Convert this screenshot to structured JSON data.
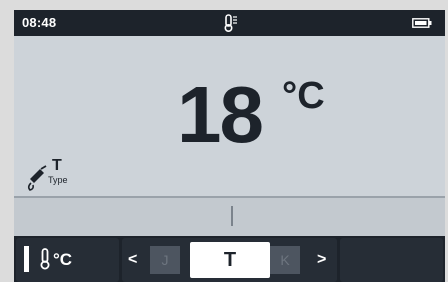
{
  "status": {
    "time": "08:48",
    "center_icon": "thermometer-icon",
    "battery_icon": "battery-icon"
  },
  "measurement": {
    "value": "18",
    "unit": "°C"
  },
  "thermocouple": {
    "icon": "thermocouple-probe-icon",
    "letter": "T",
    "label": "Type"
  },
  "softkeys": {
    "unit_key": {
      "icon": "thermometer-icon",
      "label": "°C"
    },
    "type_selector": {
      "prev_arrow": "<",
      "previous": "J",
      "selected": "T",
      "next": "K",
      "next_arrow": ">"
    },
    "right_key_label": ""
  },
  "colors": {
    "screen_bg": "#cdd3d9",
    "bar_dark": "#1d232b",
    "text_dark": "#1d232b",
    "selected_bg": "#ffffff"
  }
}
